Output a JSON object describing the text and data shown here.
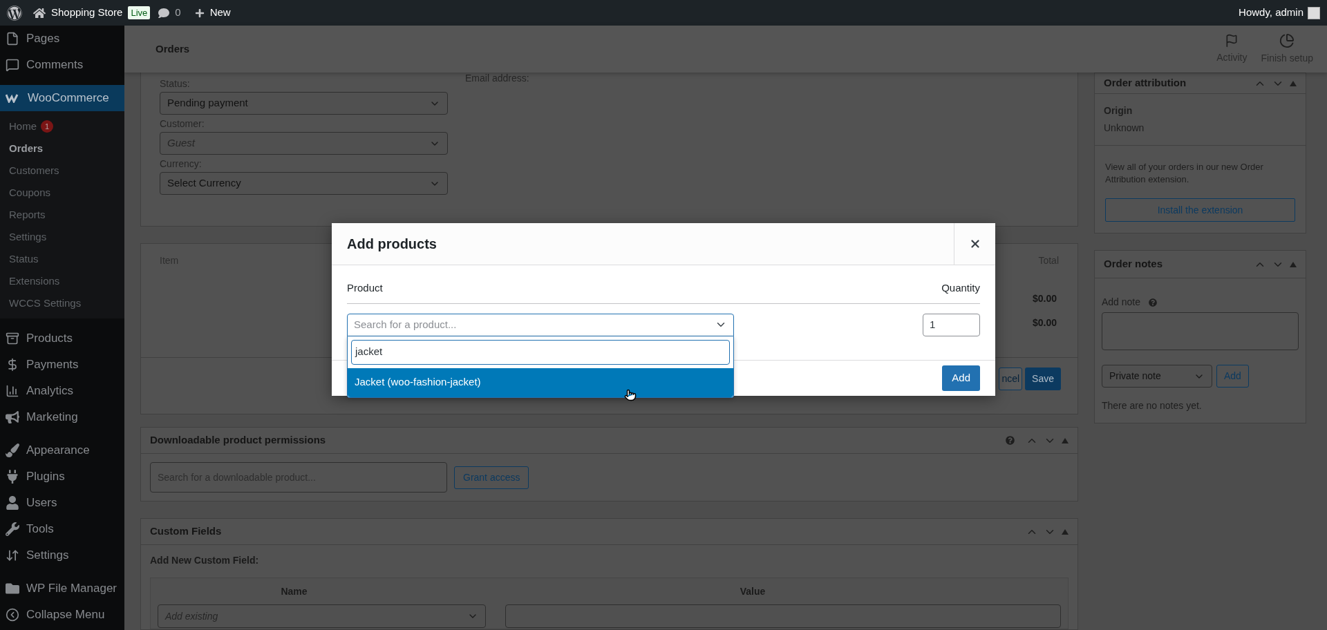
{
  "topbar": {
    "site_name": "Shopping Store",
    "live_badge": "Live",
    "comments_count": "0",
    "new_label": "New",
    "greeting": "Howdy, admin"
  },
  "sidebar": {
    "items": [
      {
        "label": "Pages",
        "selected": false
      },
      {
        "label": "Comments",
        "selected": false
      },
      {
        "label": "WooCommerce",
        "selected": true,
        "children": [
          {
            "label": "Home",
            "selected": false,
            "badge": "1"
          },
          {
            "label": "Orders",
            "selected": true
          },
          {
            "label": "Customers",
            "selected": false
          },
          {
            "label": "Coupons",
            "selected": false
          },
          {
            "label": "Reports",
            "selected": false
          },
          {
            "label": "Settings",
            "selected": false
          },
          {
            "label": "Status",
            "selected": false
          },
          {
            "label": "Extensions",
            "selected": false
          },
          {
            "label": "WCCS Settings",
            "selected": false
          }
        ]
      },
      {
        "label": "Products",
        "selected": false
      },
      {
        "label": "Payments",
        "selected": false
      },
      {
        "label": "Analytics",
        "selected": false
      },
      {
        "label": "Marketing",
        "selected": false
      },
      {
        "label": "Appearance",
        "selected": false
      },
      {
        "label": "Plugins",
        "selected": false
      },
      {
        "label": "Users",
        "selected": false
      },
      {
        "label": "Tools",
        "selected": false
      },
      {
        "label": "Settings",
        "selected": false
      },
      {
        "label": "WP File Manager",
        "selected": false
      },
      {
        "label": "Collapse Menu",
        "selected": false
      }
    ]
  },
  "header": {
    "title": "Orders",
    "actions": [
      "Activity",
      "Finish setup"
    ]
  },
  "order_details": {
    "fields": [
      {
        "label": "Status:",
        "value": "Pending payment"
      },
      {
        "label": "Customer:",
        "placeholder": "Guest"
      },
      {
        "label": "Currency:",
        "value": "Select Currency"
      }
    ],
    "email_label": "Email address:"
  },
  "items_panel": {
    "column_1": "Item",
    "total_label": "Total",
    "totals": [
      "$0.00",
      "$0.00"
    ],
    "buttons": [
      "ncel",
      "Save"
    ]
  },
  "downloads": {
    "title": "Downloadable product permissions",
    "search_placeholder": "Search for a downloadable product...",
    "button": "Grant access"
  },
  "custom_fields": {
    "title": "Custom Fields",
    "subtitle": "Add New Custom Field:",
    "columns": [
      "Name",
      "Value"
    ],
    "name_placeholder": "Add existing"
  },
  "attribution": {
    "title": "Order attribution",
    "origin_label": "Origin",
    "origin_value": "Unknown",
    "text": "View all of your orders in our new Order Attribution extension.",
    "button": "Install the extension"
  },
  "notes": {
    "title": "Order notes",
    "add_note_label": "Add note",
    "note_type": "Private note",
    "add_button": "Add",
    "empty": "There are no notes yet."
  },
  "modal": {
    "title": "Add products",
    "product_label": "Product",
    "quantity_label": "Quantity",
    "select_placeholder": "Search for a product...",
    "search_value": "jacket",
    "results": [
      {
        "label": "Jacket (woo-fashion-jacket)",
        "selected": true
      }
    ],
    "quantity": "1",
    "add_button": "Add"
  }
}
